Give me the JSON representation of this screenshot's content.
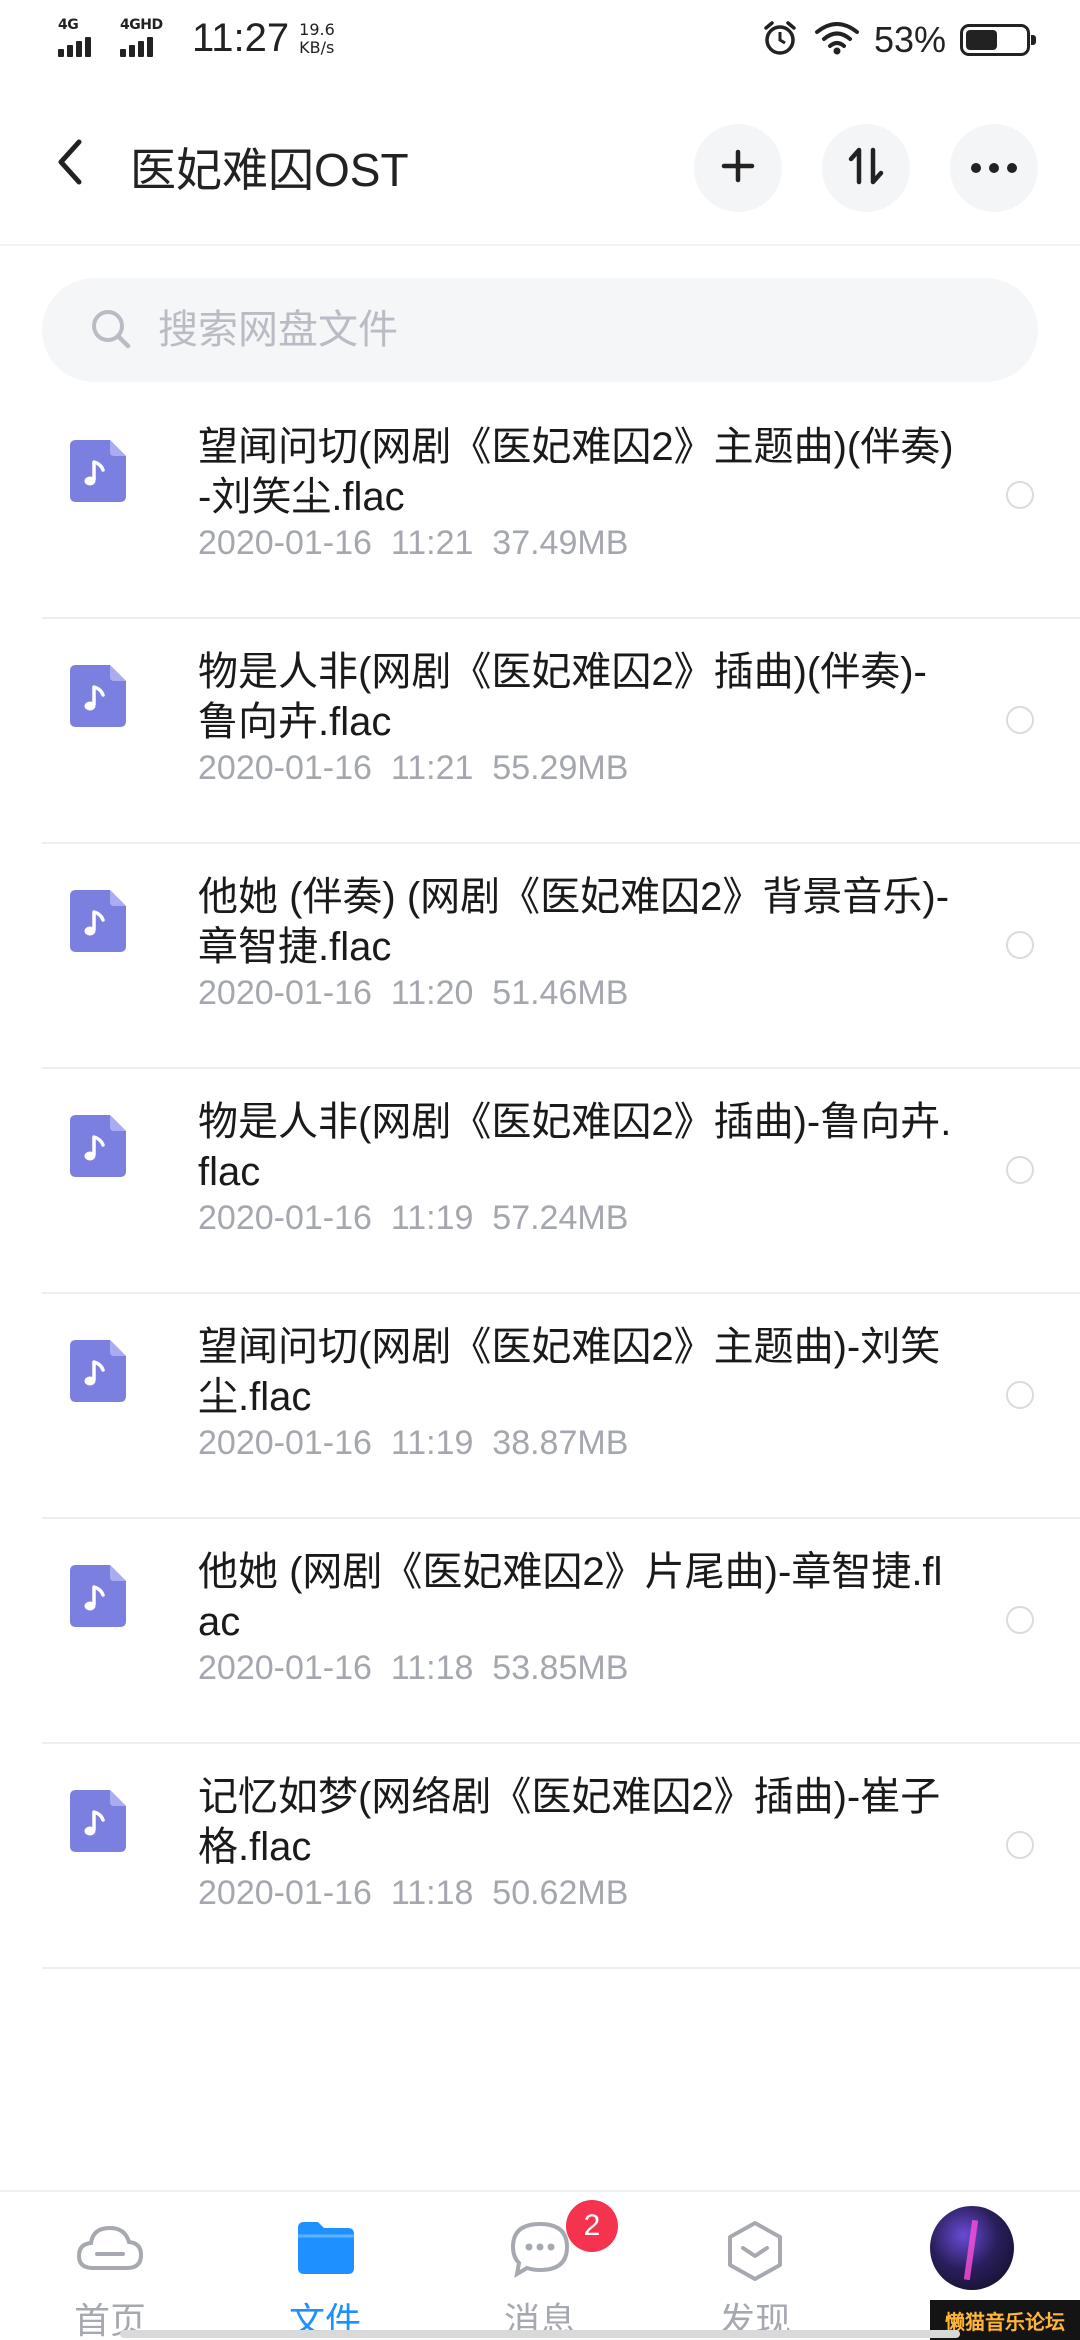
{
  "status_bar": {
    "network1": "4G",
    "network2": "4GHD",
    "time": "11:27",
    "speed_value": "19.6",
    "speed_unit": "KB/s",
    "battery_percent": "53%",
    "battery_level": 0.53,
    "icons": [
      "signal-icon",
      "alarm-icon",
      "wifi-icon",
      "battery-icon"
    ]
  },
  "header": {
    "title": "医妃难囚OST",
    "icons": [
      "back-arrow-icon",
      "plus-icon",
      "sort-icon",
      "more-icon"
    ]
  },
  "search": {
    "placeholder": "搜索网盘文件"
  },
  "files": [
    {
      "name": "望闻问切(网剧《医妃难囚2》主题曲)(伴奏)-刘笑尘.flac",
      "date": "2020-01-16",
      "time": "11:21",
      "size": "37.49MB"
    },
    {
      "name": "物是人非(网剧《医妃难囚2》插曲)(伴奏)-鲁向卉.flac",
      "date": "2020-01-16",
      "time": "11:21",
      "size": "55.29MB"
    },
    {
      "name": "他她 (伴奏) (网剧《医妃难囚2》背景音乐)-章智捷.flac",
      "date": "2020-01-16",
      "time": "11:20",
      "size": "51.46MB"
    },
    {
      "name": "物是人非(网剧《医妃难囚2》插曲)-鲁向卉.flac",
      "date": "2020-01-16",
      "time": "11:19",
      "size": "57.24MB"
    },
    {
      "name": "望闻问切(网剧《医妃难囚2》主题曲)-刘笑尘.flac",
      "date": "2020-01-16",
      "time": "11:19",
      "size": "38.87MB"
    },
    {
      "name": "他她 (网剧《医妃难囚2》片尾曲)-章智捷.flac",
      "date": "2020-01-16",
      "time": "11:18",
      "size": "53.85MB"
    },
    {
      "name": "记忆如梦(网络剧《医妃难囚2》插曲)-崔子格.flac",
      "date": "2020-01-16",
      "time": "11:18",
      "size": "50.62MB"
    }
  ],
  "bottom_nav": {
    "items": [
      {
        "label": "首页",
        "icon": "cloud-icon",
        "active": false
      },
      {
        "label": "文件",
        "icon": "folder-icon",
        "active": true
      },
      {
        "label": "消息",
        "icon": "message-icon",
        "active": false
      },
      {
        "label": "发现",
        "icon": "discover-icon",
        "active": false
      }
    ],
    "message_badge": "2"
  },
  "watermark": "懒猫音乐论坛",
  "colors": {
    "accent": "#1e90ff",
    "file_icon": "#7b7fe0",
    "badge": "#f5334f",
    "meta_text": "#a4a7ae"
  }
}
